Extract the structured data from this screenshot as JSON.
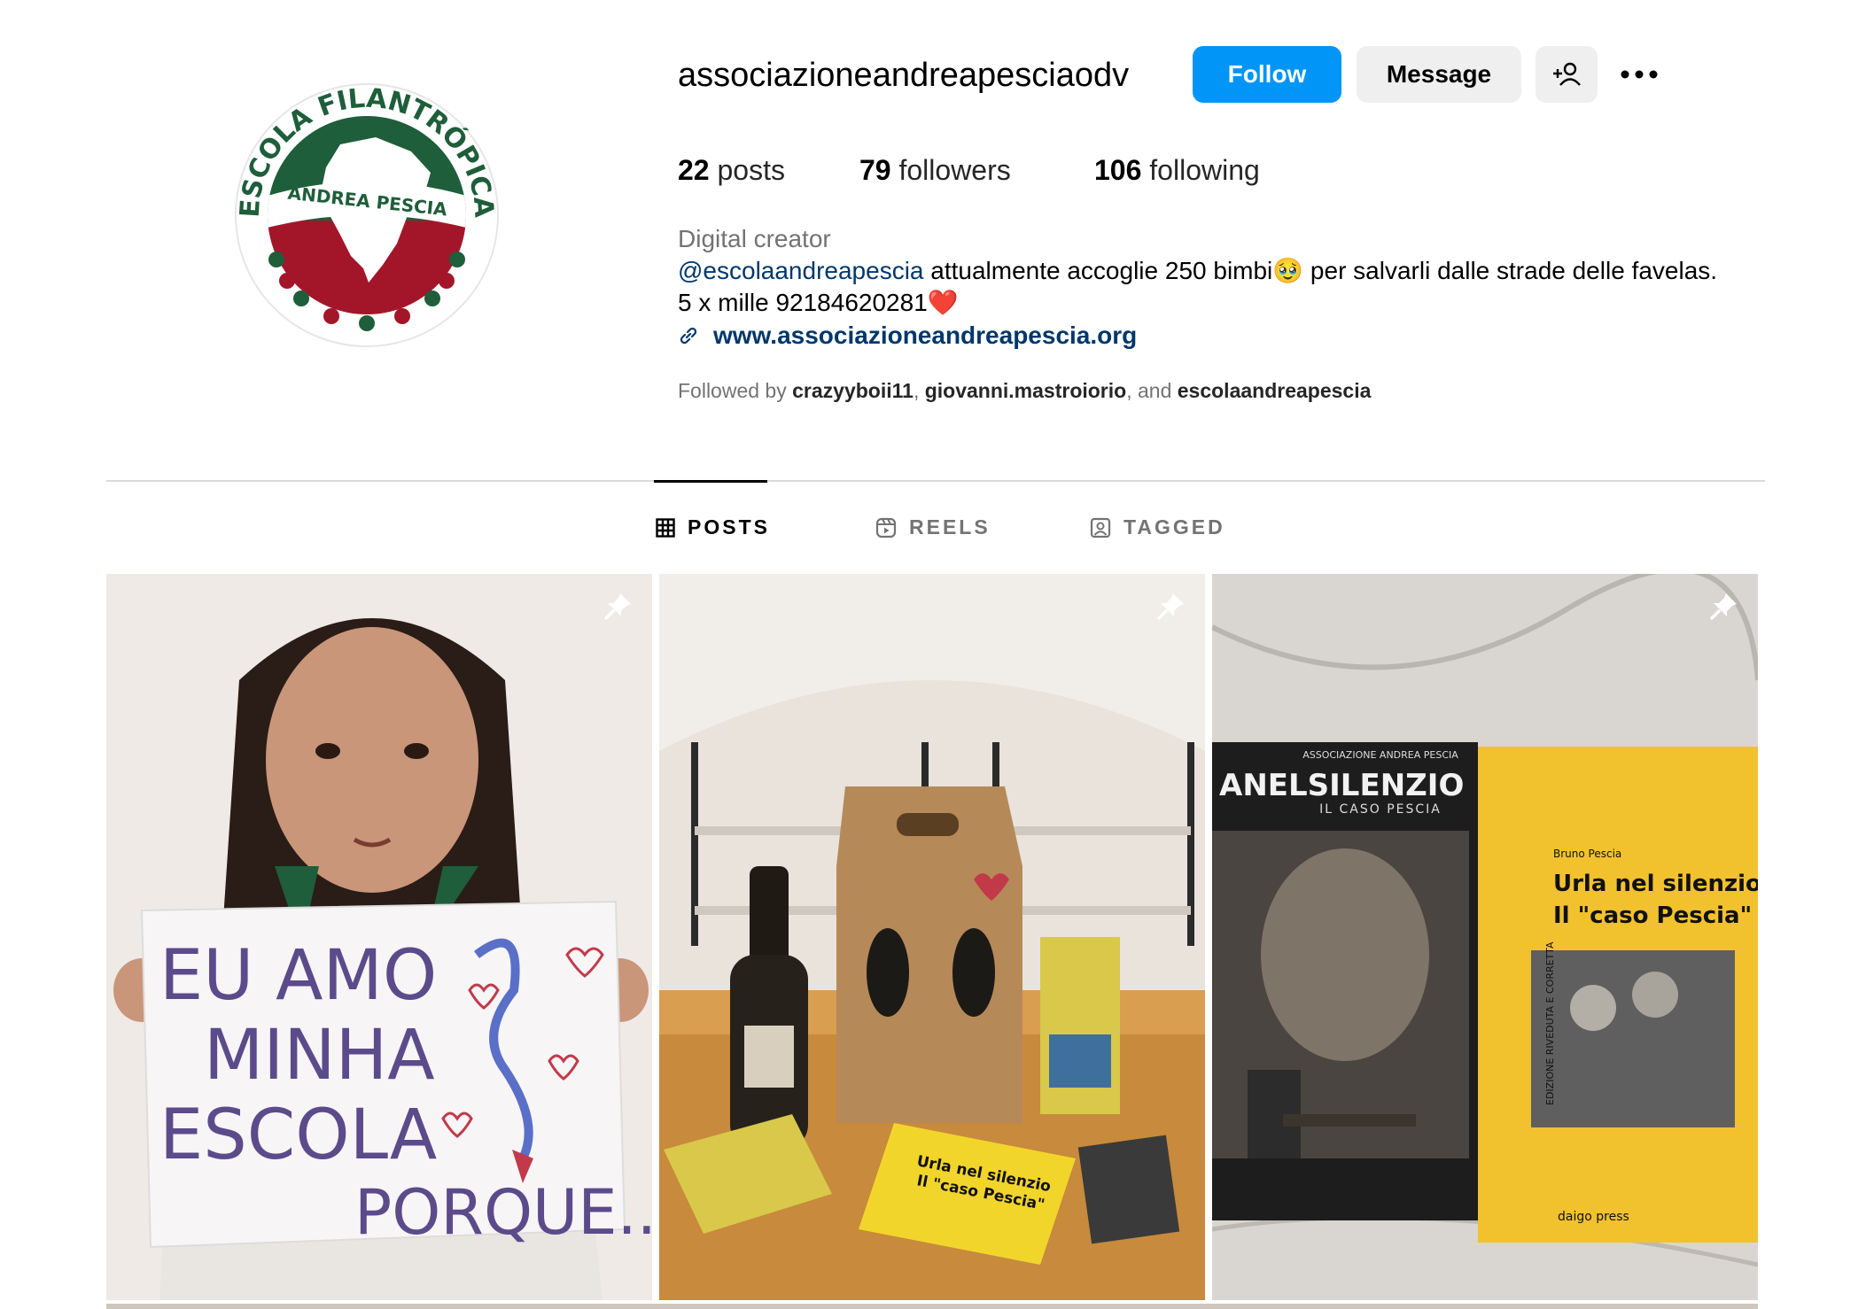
{
  "profile": {
    "username": "associazioneandreapesciaodv",
    "follow_label": "Follow",
    "message_label": "Message",
    "avatar_logo_text": {
      "top": "ESCOLA FILANTRÓPICA",
      "middle": "ANDREA PESCIA"
    }
  },
  "stats": {
    "posts_count": "22",
    "posts_label": "posts",
    "followers_count": "79",
    "followers_label": "followers",
    "following_count": "106",
    "following_label": "following"
  },
  "bio": {
    "category": "Digital creator",
    "mention": "@escolaandreapescia",
    "line1_rest": " attualmente accoglie 250 bimbi🥹 per salvarli dalle strade delle favelas.",
    "line2": "5 x mille 92184620281❤️",
    "link": "www.associazioneandreapescia.org",
    "followed_by_prefix": "Followed by ",
    "followed_by_user1": "crazyyboii11",
    "sep1": ", ",
    "followed_by_user2": "giovanni.mastroiorio",
    "sep2": ", and ",
    "followed_by_user3": "escolaandreapescia"
  },
  "tabs": [
    {
      "label": "POSTS",
      "active": true,
      "icon": "grid-icon"
    },
    {
      "label": "REELS",
      "active": false,
      "icon": "reels-icon"
    },
    {
      "label": "TAGGED",
      "active": false,
      "icon": "tagged-icon"
    }
  ],
  "posts": [
    {
      "pinned": true,
      "sign_lines": [
        "EU AMO",
        "MINHA",
        "ESCOLA",
        "PORQUE...."
      ]
    },
    {
      "pinned": true,
      "book_title": [
        "Urla nel silenzio",
        "Il \"caso Pescia\""
      ]
    },
    {
      "pinned": true,
      "dvd_title": "ANELSILENZIO",
      "dvd_association": "ASSOCIAZIONE ANDREA PESCIA",
      "dvd_subtitle": "IL CASO PESCIA",
      "book_author": "Bruno Pescia",
      "book_title_1": "Urla nel silenzio",
      "book_title_2": "Il \"caso Pescia\"",
      "book_side": "EDIZIONE RIVEDUTA E CORRETTA",
      "publisher": "daigo press"
    }
  ],
  "colors": {
    "follow_button": "#0095f6",
    "secondary_button": "#efefef",
    "link": "#00376b",
    "muted_text": "#737373",
    "logo_green": "#1e5e3a",
    "logo_red": "#a3162a"
  }
}
